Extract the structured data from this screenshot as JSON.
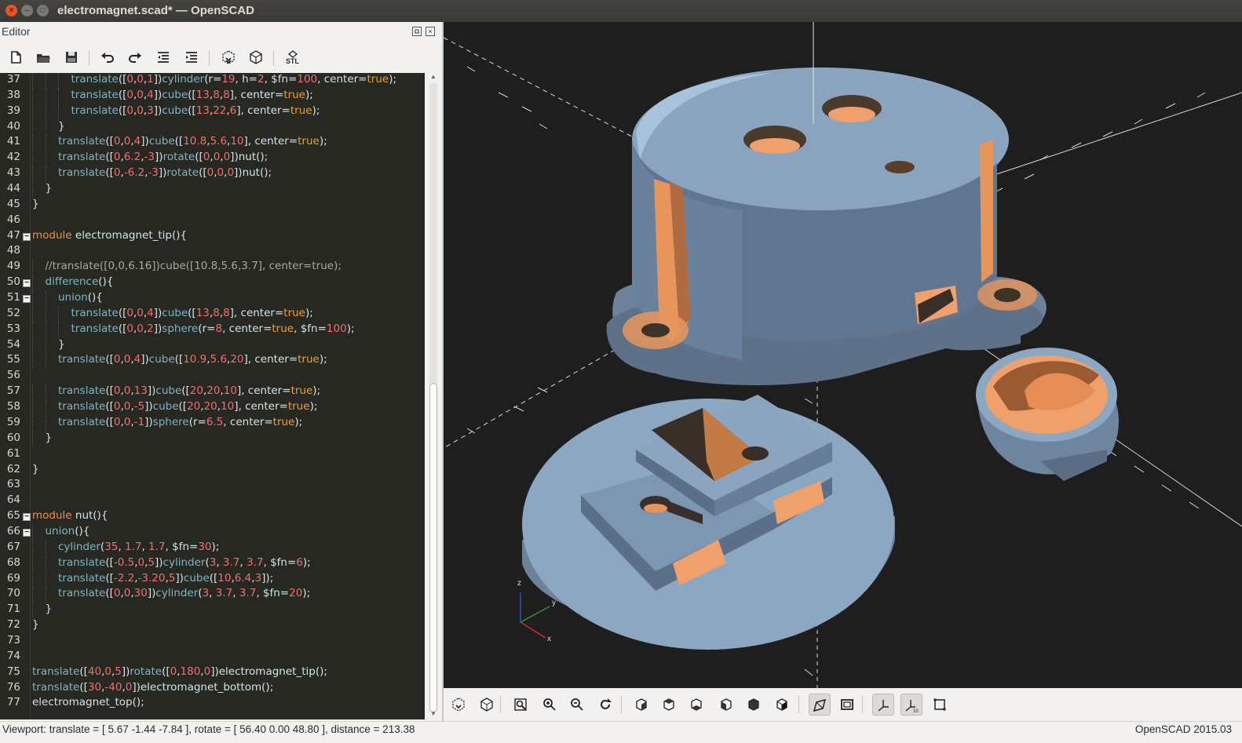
{
  "window": {
    "title": "electromagnet.scad* — OpenSCAD"
  },
  "editor": {
    "header": "Editor",
    "toolbar": [
      "new-file-icon",
      "open-file-icon",
      "save-file-icon",
      "undo-icon",
      "redo-icon",
      "unindent-icon",
      "indent-icon",
      "preview-icon",
      "render-icon",
      "export-stl-icon"
    ],
    "stl_label": "STL",
    "lines": [
      {
        "n": "37",
        "indent": 3,
        "t": "translate([0,0,1])cylinder(r=19, h=2, $fn=100, center=true);"
      },
      {
        "n": "38",
        "indent": 3,
        "t": "translate([0,0,4])cube([13,8,8], center=true);"
      },
      {
        "n": "39",
        "indent": 3,
        "t": "translate([0,0,3])cube([13,22,6], center=true);"
      },
      {
        "n": "40",
        "indent": 2,
        "t": "}"
      },
      {
        "n": "41",
        "indent": 2,
        "t": "translate([0,0,4])cube([10.8,5.6,10], center=true);"
      },
      {
        "n": "42",
        "indent": 2,
        "t": "translate([0,6.2,-3])rotate([0,0,0])nut();"
      },
      {
        "n": "43",
        "indent": 2,
        "t": "translate([0,-6.2,-3])rotate([0,0,0])nut();"
      },
      {
        "n": "44",
        "indent": 1,
        "t": "}"
      },
      {
        "n": "45",
        "indent": 0,
        "t": "}"
      },
      {
        "n": "46",
        "indent": 0,
        "t": ""
      },
      {
        "n": "47",
        "indent": 0,
        "t": "module electromagnet_tip(){",
        "fold": true
      },
      {
        "n": "48",
        "indent": 0,
        "t": ""
      },
      {
        "n": "49",
        "indent": 1,
        "t": "//translate([0,0,6.16])cube([10.8,5.6,3.7], center=true);",
        "comment": true
      },
      {
        "n": "50",
        "indent": 1,
        "t": "difference(){",
        "fold": true
      },
      {
        "n": "51",
        "indent": 2,
        "t": "union(){",
        "fold": true
      },
      {
        "n": "52",
        "indent": 3,
        "t": "translate([0,0,4])cube([13,8,8], center=true);"
      },
      {
        "n": "53",
        "indent": 3,
        "t": "translate([0,0,2])sphere(r=8, center=true, $fn=100);"
      },
      {
        "n": "54",
        "indent": 2,
        "t": "}"
      },
      {
        "n": "55",
        "indent": 2,
        "t": "translate([0,0,4])cube([10.9,5.6,20], center=true);"
      },
      {
        "n": "56",
        "indent": 0,
        "t": ""
      },
      {
        "n": "57",
        "indent": 2,
        "t": "translate([0,0,13])cube([20,20,10], center=true);"
      },
      {
        "n": "58",
        "indent": 2,
        "t": "translate([0,0,-5])cube([20,20,10], center=true);"
      },
      {
        "n": "59",
        "indent": 2,
        "t": "translate([0,0,-1])sphere(r=6.5, center=true);"
      },
      {
        "n": "60",
        "indent": 1,
        "t": "}"
      },
      {
        "n": "61",
        "indent": 0,
        "t": ""
      },
      {
        "n": "62",
        "indent": 0,
        "t": "}"
      },
      {
        "n": "63",
        "indent": 0,
        "t": ""
      },
      {
        "n": "64",
        "indent": 0,
        "t": ""
      },
      {
        "n": "65",
        "indent": 0,
        "t": "module nut(){",
        "fold": true
      },
      {
        "n": "66",
        "indent": 1,
        "t": "union(){",
        "fold": true
      },
      {
        "n": "67",
        "indent": 2,
        "t": "cylinder(35, 1.7, 1.7, $fn=30);"
      },
      {
        "n": "68",
        "indent": 2,
        "t": "translate([-0.5,0,5])cylinder(3, 3.7, 3.7, $fn=6);"
      },
      {
        "n": "69",
        "indent": 2,
        "t": "translate([-2.2,-3.20,5])cube([10,6.4,3]);"
      },
      {
        "n": "70",
        "indent": 2,
        "t": "translate([0,0,30])cylinder(3, 3.7, 3.7, $fn=20);"
      },
      {
        "n": "71",
        "indent": 1,
        "t": "}"
      },
      {
        "n": "72",
        "indent": 0,
        "t": "}"
      },
      {
        "n": "73",
        "indent": 0,
        "t": ""
      },
      {
        "n": "74",
        "indent": 0,
        "t": ""
      },
      {
        "n": "75",
        "indent": 0,
        "t": "translate([40,0,5])rotate([0,180,0])electromagnet_tip();"
      },
      {
        "n": "76",
        "indent": 0,
        "t": "translate([30,-40,0])electromagnet_bottom();"
      },
      {
        "n": "77",
        "indent": 0,
        "t": "electromagnet_top();"
      }
    ]
  },
  "viewport": {
    "axis_labels": {
      "z": "z",
      "y": "y",
      "x": "x"
    },
    "colors": {
      "background": "#1e1e1e",
      "model_face": "#7d97b3",
      "model_cut": "#f0a06a"
    }
  },
  "view_toolbar": [
    "preview-icon",
    "render-icon",
    "view-all-icon",
    "zoom-in-icon",
    "zoom-out-icon",
    "reset-view-icon",
    "view-right-icon",
    "view-top-icon",
    "view-bottom-icon",
    "view-left-icon",
    "view-front-icon",
    "view-back-icon",
    "perspective-icon",
    "orthogonal-icon",
    "show-axes-icon",
    "show-scale-markers-icon",
    "show-edges-icon"
  ],
  "status": {
    "viewport": "Viewport: translate = [ 5.67 -1.44 -7.84 ], rotate = [ 56.40 0.00 48.80 ], distance = 213.38",
    "version": "OpenSCAD 2015.03"
  }
}
